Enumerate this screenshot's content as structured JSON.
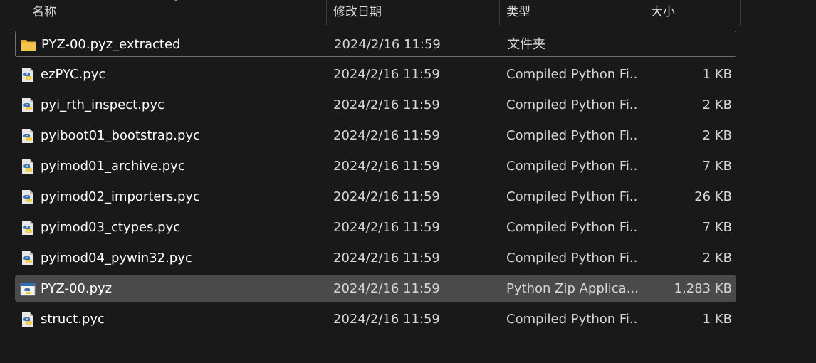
{
  "columns": {
    "name": "名称",
    "date": "修改日期",
    "type": "类型",
    "size": "大小"
  },
  "files": [
    {
      "name": "PYZ-00.pyz_extracted",
      "date": "2024/2/16 11:59",
      "type": "文件夹",
      "size": "",
      "icon": "folder-icon",
      "state": "focused"
    },
    {
      "name": "ezPYC.pyc",
      "date": "2024/2/16 11:59",
      "type": "Compiled Python Fi...",
      "size": "1 KB",
      "icon": "python-file-icon",
      "state": ""
    },
    {
      "name": "pyi_rth_inspect.pyc",
      "date": "2024/2/16 11:59",
      "type": "Compiled Python Fi...",
      "size": "2 KB",
      "icon": "python-file-icon",
      "state": ""
    },
    {
      "name": "pyiboot01_bootstrap.pyc",
      "date": "2024/2/16 11:59",
      "type": "Compiled Python Fi...",
      "size": "2 KB",
      "icon": "python-file-icon",
      "state": ""
    },
    {
      "name": "pyimod01_archive.pyc",
      "date": "2024/2/16 11:59",
      "type": "Compiled Python Fi...",
      "size": "7 KB",
      "icon": "python-file-icon",
      "state": ""
    },
    {
      "name": "pyimod02_importers.pyc",
      "date": "2024/2/16 11:59",
      "type": "Compiled Python Fi...",
      "size": "26 KB",
      "icon": "python-file-icon",
      "state": ""
    },
    {
      "name": "pyimod03_ctypes.pyc",
      "date": "2024/2/16 11:59",
      "type": "Compiled Python Fi...",
      "size": "7 KB",
      "icon": "python-file-icon",
      "state": ""
    },
    {
      "name": "pyimod04_pywin32.pyc",
      "date": "2024/2/16 11:59",
      "type": "Compiled Python Fi...",
      "size": "2 KB",
      "icon": "python-file-icon",
      "state": ""
    },
    {
      "name": "PYZ-00.pyz",
      "date": "2024/2/16 11:59",
      "type": "Python Zip Applica...",
      "size": "1,283 KB",
      "icon": "python-zip-app-icon",
      "state": "selected"
    },
    {
      "name": "struct.pyc",
      "date": "2024/2/16 11:59",
      "type": "Compiled Python Fi...",
      "size": "1 KB",
      "icon": "python-file-icon",
      "state": ""
    }
  ],
  "colors": {
    "background": "#191919",
    "selected_row": "#4a4a4a",
    "focus_border": "#6e6e6e",
    "folder": "#f5c44a"
  }
}
